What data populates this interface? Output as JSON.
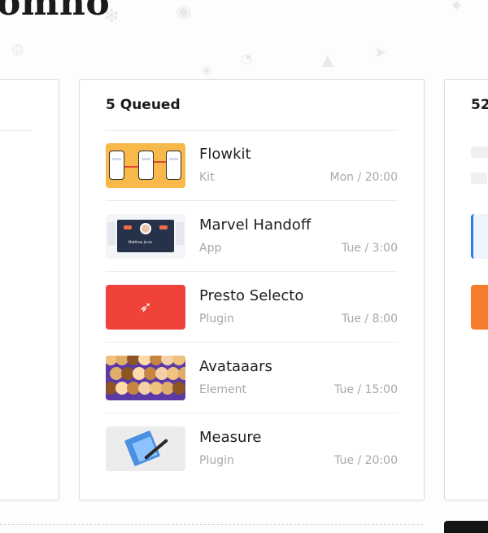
{
  "page": {
    "title_fragment": "omno"
  },
  "queue_card": {
    "title": "5 Queued",
    "items": [
      {
        "name": "Flowkit",
        "type": "Kit",
        "time": "Mon / 20:00",
        "thumb_icon": "flowkit-thumbnail"
      },
      {
        "name": "Marvel Handoff",
        "type": "App",
        "time": "Tue / 3:00",
        "thumb_icon": "marvel-handoff-thumbnail",
        "thumb_caption": "Matthew Jones"
      },
      {
        "name": "Presto Selecto",
        "type": "Plugin",
        "time": "Tue / 8:00",
        "thumb_icon": "presto-selecto-thumbnail"
      },
      {
        "name": "Avataaars",
        "type": "Element",
        "time": "Tue / 15:00",
        "thumb_icon": "avataaars-thumbnail"
      },
      {
        "name": "Measure",
        "type": "Plugin",
        "time": "Tue / 20:00",
        "thumb_icon": "measure-thumbnail"
      }
    ]
  },
  "right_card": {
    "title_fragment": "52"
  },
  "colors": {
    "flowkit": "#f9b94a",
    "presto": "#ef4238",
    "avataaars": "#5b3aa8",
    "marvel_panel": "#25324a",
    "right_blue": "#2f7de1",
    "right_orange": "#f47c2c",
    "text_muted": "#a8a8a8"
  }
}
